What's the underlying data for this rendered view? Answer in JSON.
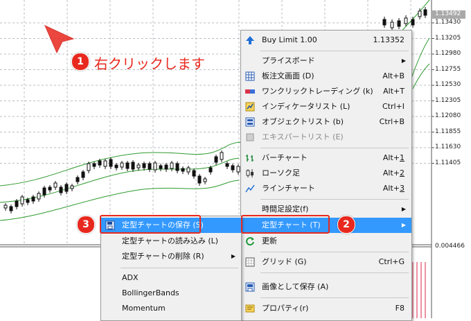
{
  "price_axis": {
    "labels": [
      "1.13430",
      "1.13205",
      "1.12980",
      "1.12755",
      "1.12530",
      "1.12305",
      "1.12080",
      "1.11855",
      "1.11630",
      "1.11405"
    ],
    "current_price": "1.13492",
    "indicator_value": "0.004466"
  },
  "annotations": {
    "step1_number": "1",
    "step1_text": "右クリックします",
    "step2_number": "2",
    "step3_number": "3"
  },
  "context_menu": {
    "buy_limit": {
      "label": "Buy Limit 1.00",
      "shortcut": "1.13352",
      "icon": "up-arrow-icon"
    },
    "price_board": {
      "label": "プライスボード"
    },
    "order_board": {
      "label": "板注文画面 (D)",
      "shortcut": "Alt+B"
    },
    "one_click": {
      "label": "ワンクリックトレーディング (k)",
      "shortcut": "Alt+T"
    },
    "indicator_list": {
      "label": "インディケータリスト (L)",
      "shortcut": "Ctrl+I"
    },
    "object_list": {
      "label": "オブジェクトリスト (b)",
      "shortcut": "Ctrl+B"
    },
    "expert_list": {
      "label": "エキスパートリスト (E)"
    },
    "bar_chart": {
      "label": "バーチャート",
      "shortcut_prefix": "Alt+",
      "shortcut_key": "1"
    },
    "candle_chart": {
      "label": "ローソク足",
      "shortcut_prefix": "Alt+",
      "shortcut_key": "2"
    },
    "line_chart": {
      "label": "ラインチャート",
      "shortcut_prefix": "Alt+",
      "shortcut_key": "3"
    },
    "timeframe": {
      "label": "時間足設定(f)"
    },
    "template": {
      "label": "定型チャート (T)"
    },
    "refresh": {
      "label": "更新"
    },
    "grid": {
      "label": "グリッド (G)",
      "shortcut": "Ctrl+G"
    },
    "save_image": {
      "label": "画像として保存 (A)"
    },
    "properties": {
      "label": "プロパティ(r)",
      "shortcut": "F8"
    }
  },
  "template_submenu": {
    "save": {
      "label": "定型チャートの保存 (S)"
    },
    "load": {
      "label": "定型チャートの読み込み (L)"
    },
    "delete": {
      "label": "定型チャートの削除 (R)"
    },
    "templates": [
      "ADX",
      "BollingerBands",
      "Momentum"
    ]
  },
  "colors": {
    "highlight": "#3399ff",
    "callout": "#e8281e",
    "band": "#2e9b2e",
    "grid": "#b8bcc2"
  }
}
